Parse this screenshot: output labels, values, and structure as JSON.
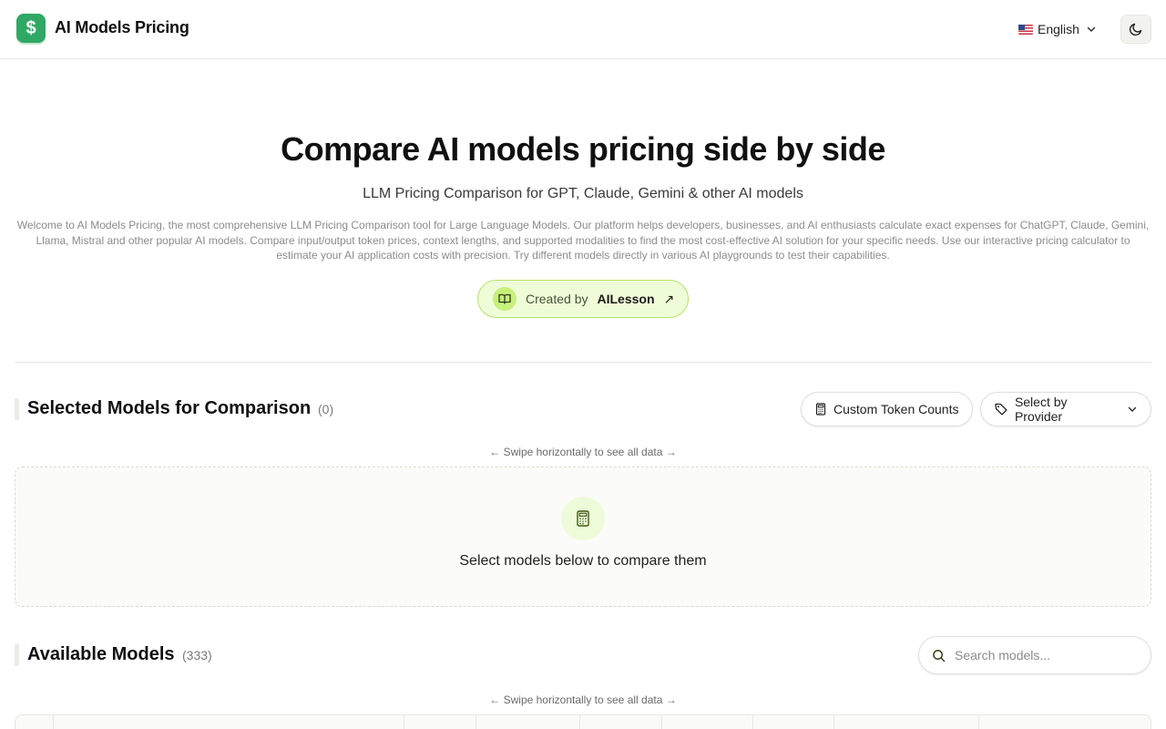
{
  "header": {
    "logo_glyph": "$",
    "brand": "AI Models Pricing",
    "language": "English",
    "theme_toggle_icon": "moon-icon"
  },
  "hero": {
    "title": "Compare AI models pricing side by side",
    "subtitle": "LLM Pricing Comparison for GPT, Claude, Gemini & other AI models",
    "description": "Welcome to AI Models Pricing, the most comprehensive LLM Pricing Comparison tool for Large Language Models. Our platform helps developers, businesses, and AI enthusiasts calculate exact expenses for ChatGPT, Claude, Gemini, Llama, Mistral and other popular AI models. Compare input/output token prices, context lengths, and supported modalities to find the most cost-effective AI solution for your specific needs. Use our interactive pricing calculator to estimate your AI application costs with precision. Try different models directly in various AI playgrounds to test their capabilities.",
    "created_by_label": "Created by",
    "created_by_name": "AILesson",
    "created_by_arrow": "↗"
  },
  "selected": {
    "title": "Selected Models for Comparison",
    "count": "(0)",
    "custom_tokens_label": "Custom Token Counts",
    "select_provider_label": "Select by Provider",
    "swipe_hint": "← Swipe horizontally to see all data →",
    "empty_text": "Select models below to compare them"
  },
  "available": {
    "title": "Available Models",
    "count": "(333)",
    "search_placeholder": "Search models...",
    "swipe_hint": "← Swipe horizontally to see all data →"
  },
  "colors": {
    "brand_green": "#2fa865",
    "lime_accent": "#c7f07c",
    "lime_border": "#b6e36a"
  }
}
